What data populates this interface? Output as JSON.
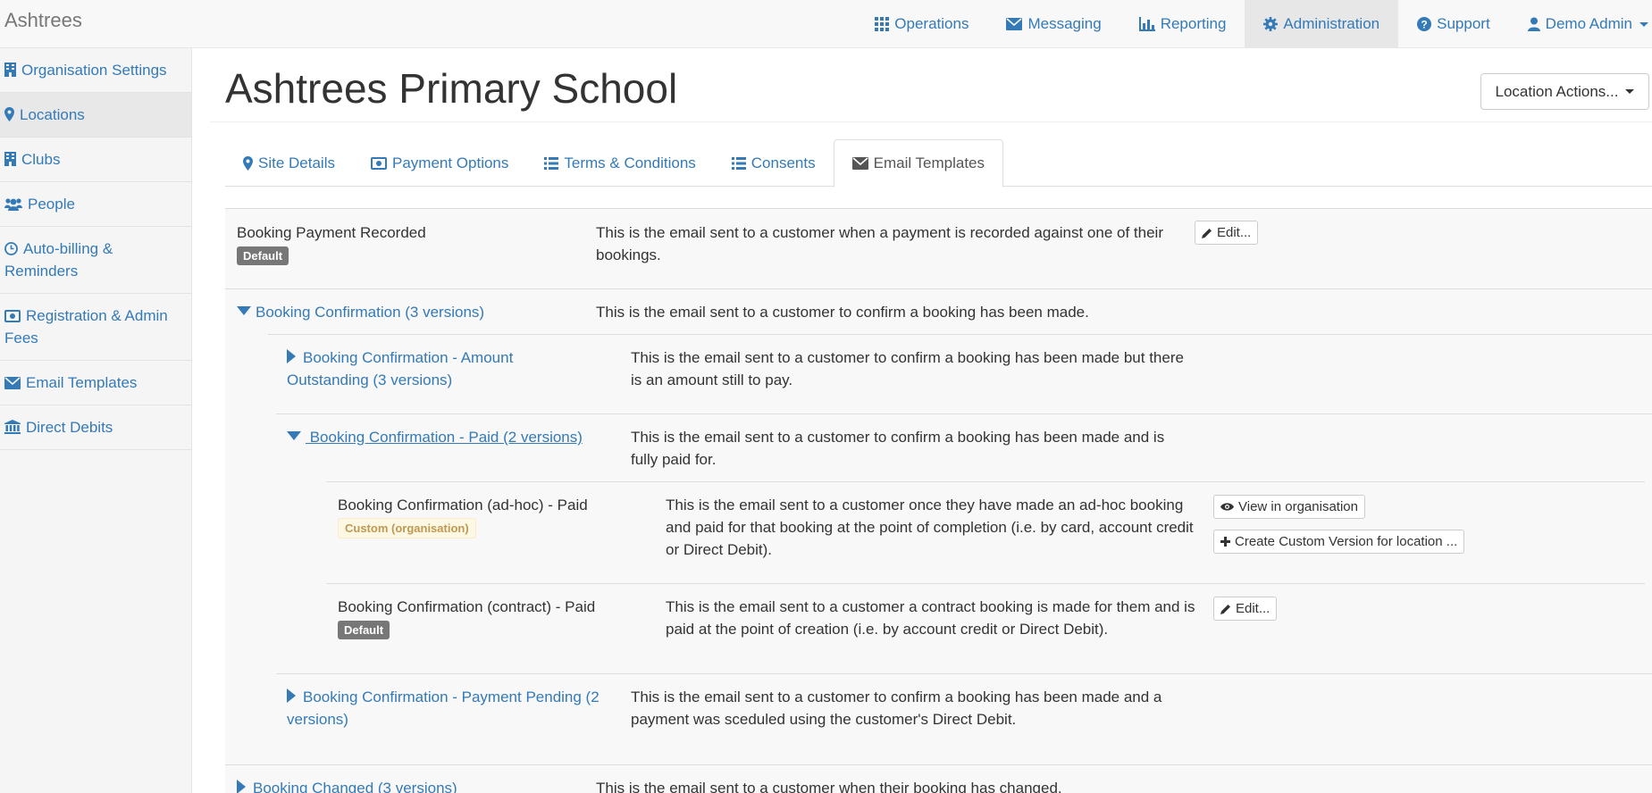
{
  "app": {
    "brand": "Ashtrees"
  },
  "navbar": {
    "items": [
      {
        "label": "Operations",
        "icon": "grid-icon"
      },
      {
        "label": "Messaging",
        "icon": "envelope-icon"
      },
      {
        "label": "Reporting",
        "icon": "bar-chart-icon"
      },
      {
        "label": "Administration",
        "icon": "gear-icon"
      },
      {
        "label": "Support",
        "icon": "question-icon"
      },
      {
        "label": "Demo Admin",
        "icon": "user-icon"
      }
    ]
  },
  "sidebar": {
    "items": [
      {
        "label": "Organisation Settings",
        "icon": "building-icon"
      },
      {
        "label": "Locations",
        "icon": "map-marker-icon"
      },
      {
        "label": "Clubs",
        "icon": "building-icon"
      },
      {
        "label": "People",
        "icon": "users-icon"
      },
      {
        "label": "Auto-billing & Reminders",
        "icon": "clock-icon"
      },
      {
        "label": "Registration & Admin Fees",
        "icon": "money-icon"
      },
      {
        "label": "Email Templates",
        "icon": "envelope-icon"
      },
      {
        "label": "Direct Debits",
        "icon": "bank-icon"
      }
    ]
  },
  "page": {
    "title": "Ashtrees Primary School",
    "actions_label": "Location Actions..."
  },
  "tabs": [
    {
      "label": "Site Details",
      "icon": "map-marker-icon"
    },
    {
      "label": "Payment Options",
      "icon": "money-icon"
    },
    {
      "label": "Terms & Conditions",
      "icon": "list-icon"
    },
    {
      "label": "Consents",
      "icon": "list-icon"
    },
    {
      "label": "Email Templates",
      "icon": "envelope-icon"
    }
  ],
  "templates": {
    "payment_recorded": {
      "name": "Booking Payment Recorded",
      "badge": "Default",
      "description": "This is the email sent to a customer when a payment is recorded against one of their bookings.",
      "edit_label": "Edit..."
    },
    "confirmation_group": {
      "name": "Booking Confirmation (3 versions)",
      "description": "This is the email sent to a customer to confirm a booking has been made."
    },
    "amount_outstanding": {
      "name": "Booking Confirmation - Amount Outstanding (3 versions)",
      "description": "This is the email sent to a customer to confirm a booking has been made but there is an amount still to pay."
    },
    "paid_group": {
      "name": " Booking Confirmation - Paid (2 versions)",
      "description": "This is the email sent to a customer to confirm a booking has been made and is fully paid for."
    },
    "adhoc_paid": {
      "name": "Booking Confirmation (ad-hoc) - Paid",
      "badge": "Custom (organisation)",
      "description": "This is the email sent to a customer once they have made an ad-hoc booking and paid for that booking at the point of completion (i.e. by card, account credit or Direct Debit).",
      "view_label": "View in organisation",
      "create_label": "Create Custom Version for location ..."
    },
    "contract_paid": {
      "name": "Booking Confirmation (contract) - Paid",
      "badge": "Default",
      "description": "This is the email sent to a customer a contract booking is made for them and is paid at the point of creation (i.e. by account credit or Direct Debit).",
      "edit_label": "Edit..."
    },
    "payment_pending": {
      "name": "Booking Confirmation - Payment Pending (2 versions)",
      "description": "This is the email sent to a customer to confirm a booking has been made and a payment was sceduled using the customer's Direct Debit."
    },
    "booking_changed": {
      "name": "Booking Changed (3 versions)",
      "description": "This is the email sent to a customer when their booking has changed."
    }
  },
  "colors": {
    "link": "#337ab7",
    "navbar_bg": "#f8f8f8",
    "badge_default": "#777777",
    "badge_custom_bg": "#fcf8e3"
  }
}
